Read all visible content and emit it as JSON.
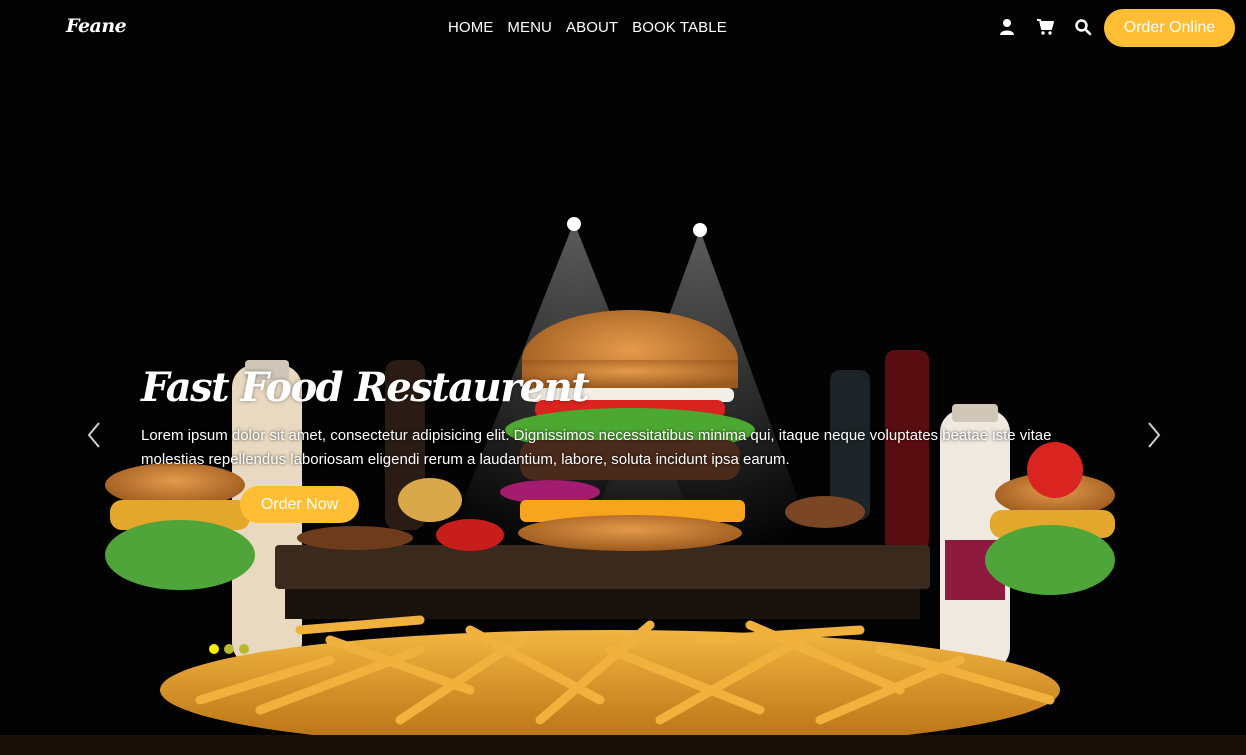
{
  "brand": {
    "logo": "Feane"
  },
  "nav": {
    "items": [
      "HOME",
      "MENU",
      "ABOUT",
      "BOOK TABLE"
    ]
  },
  "header_icons": [
    "user-icon",
    "cart-icon",
    "search-icon"
  ],
  "header": {
    "cta_label": "Order Online"
  },
  "slide": {
    "title": "Fast Food Restaurent",
    "text": "Lorem ipsum dolor sit amet, consectetur adipisicing elit. Dignissimos necessitatibus minima qui, itaque neque voluptates beatae iste vitae molestias repellendus laboriosam eligendi rerum a laudantium, labore, soluta incidunt ipsa earum.",
    "cta_label": "Order Now"
  },
  "carousel": {
    "slide_count": 3,
    "active_index": 0
  },
  "colors": {
    "accent": "#ffbe33",
    "background": "#000000",
    "dot_active": "#ffee00",
    "dot_inactive": "#b9b930"
  }
}
